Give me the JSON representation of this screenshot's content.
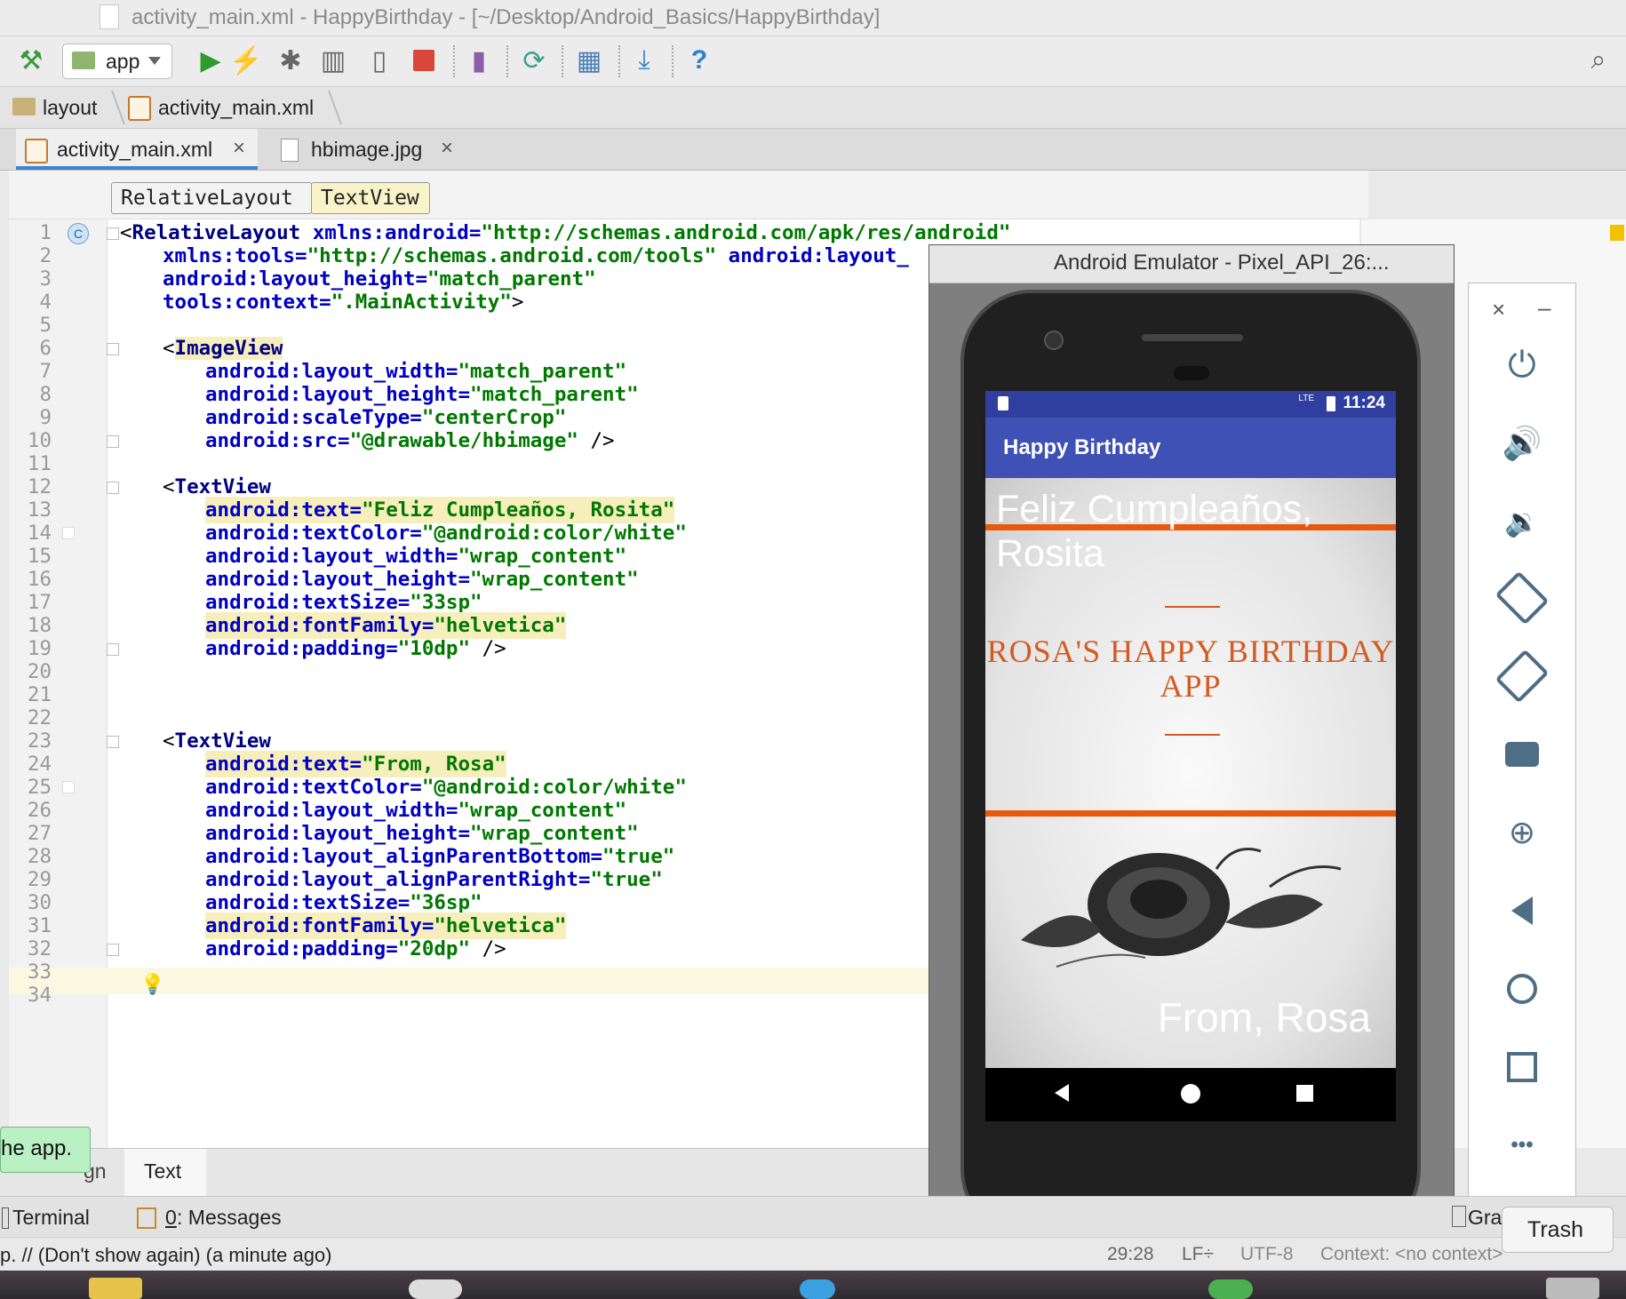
{
  "window": {
    "title": "activity_main.xml - HappyBirthday - [~/Desktop/Android_Basics/HappyBirthday]"
  },
  "toolbar": {
    "run_config": "app"
  },
  "breadcrumb": {
    "items": [
      "layout",
      "activity_main.xml"
    ]
  },
  "tabs": [
    {
      "label": "activity_main.xml",
      "close": "×"
    },
    {
      "label": "hbimage.jpg",
      "close": "×"
    }
  ],
  "element_path": [
    "RelativeLayout",
    "TextView"
  ],
  "editor": {
    "line_numbers": [
      "1",
      "2",
      "3",
      "4",
      "5",
      "6",
      "7",
      "8",
      "9",
      "10",
      "11",
      "12",
      "13",
      "14",
      "15",
      "16",
      "17",
      "18",
      "19",
      "20",
      "21",
      "22",
      "23",
      "24",
      "25",
      "26",
      "27",
      "28",
      "29",
      "30",
      "31",
      "32",
      "33",
      "34"
    ],
    "gutter_badge": "C",
    "lines": {
      "l1": {
        "lt": "<",
        "tag": "RelativeLayout",
        "a": " xmlns:android=",
        "v": "\"http://schemas.android.com/apk/res/android\""
      },
      "l2": {
        "a": "xmlns:tools=",
        "v": "\"http://schemas.android.com/tools\"",
        "a2": " android:layout_"
      },
      "l3": {
        "a": "android:layout_height=",
        "v": "\"match_parent\""
      },
      "l4": {
        "a": "tools:context=",
        "v": "\".MainActivity\"",
        "end": ">"
      },
      "l6": {
        "lt": "<",
        "tag": "ImageView"
      },
      "l7": {
        "a": "android:layout_width=",
        "v": "\"match_parent\""
      },
      "l8": {
        "a": "android:layout_height=",
        "v": "\"match_parent\""
      },
      "l9": {
        "a": "android:scaleType=",
        "v": "\"centerCrop\""
      },
      "l10": {
        "a": "android:src=",
        "v": "\"@drawable/hbimage\"",
        "end": " />"
      },
      "l12": {
        "lt": "<",
        "tag": "TextView"
      },
      "l13": {
        "a": "android:text=",
        "v": "\"Feliz Cumpleaños, Rosita\""
      },
      "l14": {
        "a": "android:textColor=",
        "v": "\"@android:color/white\""
      },
      "l15": {
        "a": "android:layout_width=",
        "v": "\"wrap_content\""
      },
      "l16": {
        "a": "android:layout_height=",
        "v": "\"wrap_content\""
      },
      "l17": {
        "a": "android:textSize=",
        "v": "\"33sp\""
      },
      "l18": {
        "a": "android:fontFamily=",
        "v": "\"helvetica\""
      },
      "l19": {
        "a": "android:padding=",
        "v": "\"10dp\"",
        "end": " />"
      },
      "l23": {
        "lt": "<",
        "tag": "TextView"
      },
      "l24": {
        "a": "android:text=",
        "v": "\"From, Rosa\""
      },
      "l25": {
        "a": "android:textColor=",
        "v": "\"@android:color/white\""
      },
      "l26": {
        "a": "android:layout_width=",
        "v": "\"wrap_content\""
      },
      "l27": {
        "a": "android:layout_height=",
        "v": "\"wrap_content\""
      },
      "l28": {
        "a": "android:layout_alignParentBottom=",
        "v": "\"true\""
      },
      "l29": {
        "a": "android:layout_alignParentRight=",
        "v": "\"true\""
      },
      "l30": {
        "a": "android:textSize=",
        "v": "\"36sp\""
      },
      "l31": {
        "a": "android:fontFamily=",
        "v": "\"helvetica\""
      },
      "l32": {
        "a": "android:padding=",
        "v": "\"20dp\"",
        "end": " />"
      }
    }
  },
  "emulator": {
    "title": "Android Emulator - Pixel_API_26:...",
    "status_time": "11:24",
    "status_lte": "LTE",
    "app_title": "Happy Birthday",
    "greeting": "Feliz Cumpleaños, Rosita",
    "card_title": "ROSA'S HAPPY BIRTHDAY APP",
    "signature": "From, Rosa"
  },
  "emulator_controls": {
    "close": "×",
    "minimize": "–",
    "more": "•••"
  },
  "bottom_tabs": {
    "design_fragment": "gn",
    "text": "Text"
  },
  "tool_windows": {
    "terminal": "Terminal",
    "messages_num": "0",
    "messages": ": Messages",
    "gradle_fragment": "Gra"
  },
  "status": {
    "message": "p. // (Don't show again) (a minute ago)",
    "position": "29:28",
    "line_sep": "LF÷",
    "encoding": "UTF-8",
    "context": "Context: <no context>"
  },
  "tip_text": "he app.",
  "trash_label": "Trash",
  "colors": {
    "appbar": "#3f51b5",
    "statusbar": "#303f9f",
    "accent_orange": "#e8590c",
    "card_text": "#d45a22"
  }
}
